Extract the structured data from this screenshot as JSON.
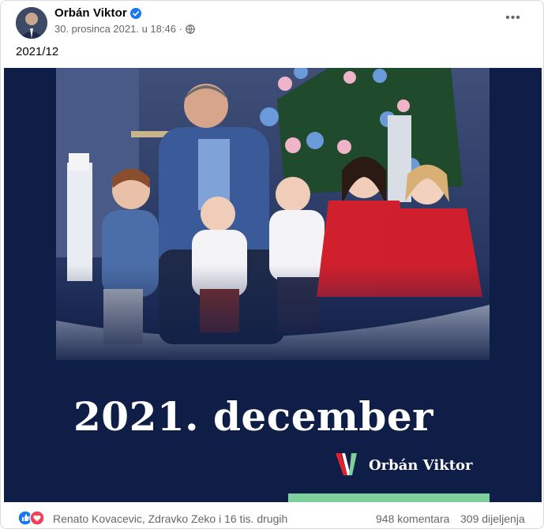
{
  "post": {
    "author": "Orbán Viktor",
    "timestamp": "30. prosinca 2021. u 18:46 ·",
    "caption": "2021/12",
    "more_label": "•••"
  },
  "image": {
    "title": "2021. december",
    "brand": "Orbán Viktor"
  },
  "footer": {
    "reactors": "Renato Kovacevic, Zdravko Zeko i 16 tis. drugih",
    "comments": "948 komentara",
    "shares": "309 dijeljenja"
  },
  "icons": [
    "verified-badge-icon",
    "globe-icon",
    "more-options-icon",
    "like-reaction-icon",
    "love-reaction-icon"
  ],
  "colors": {
    "verified": "#1877f2",
    "image_bg": "#0f1e47",
    "accent_red": "#e3202d",
    "accent_green": "#7fcf9c",
    "love": "#f33e58"
  }
}
